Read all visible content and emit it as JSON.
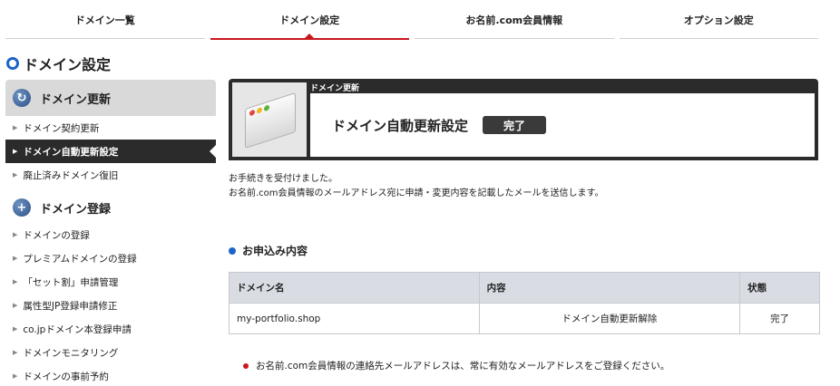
{
  "topnav": {
    "tabs": [
      {
        "label": "ドメイン一覧",
        "active": false
      },
      {
        "label": "ドメイン設定",
        "active": true
      },
      {
        "label": "お名前.com会員情報",
        "active": false
      },
      {
        "label": "オプション設定",
        "active": false
      }
    ]
  },
  "page": {
    "title": "ドメイン設定"
  },
  "sidebar": {
    "group1": {
      "title": "ドメイン更新",
      "icon": "refresh-icon",
      "items": [
        "ドメイン契約更新",
        "ドメイン自動更新設定",
        "廃止済みドメイン復旧"
      ],
      "active_index": 1
    },
    "group2": {
      "title": "ドメイン登録",
      "icon": "plus-circle-icon",
      "items": [
        "ドメインの登録",
        "プレミアムドメインの登録",
        "「セット割」申請管理",
        "属性型JP登録申請修正",
        "co.jpドメイン本登録申請",
        "ドメインモニタリング",
        "ドメインの事前予約"
      ]
    }
  },
  "banner": {
    "small_label": "ドメイン更新",
    "title": "ドメイン自動更新設定",
    "badge": "完了",
    "icon": "browser-window-icon"
  },
  "message": {
    "line1": "お手続きを受付けました。",
    "line2": "お名前.com会員情報のメールアドレス宛に申請・変更内容を記載したメールを送信します。"
  },
  "section": {
    "title": "お申込み内容"
  },
  "table": {
    "headers": [
      "ドメイン名",
      "内容",
      "状態"
    ],
    "rows": [
      [
        "my-portfolio.shop",
        "ドメイン自動更新解除",
        "完了"
      ]
    ]
  },
  "notice": {
    "text": "お名前.com会員情報の連絡先メールアドレスは、常に有効なメールアドレスをご登録ください。"
  },
  "colors": {
    "accent_red": "#c8161d",
    "accent_blue": "#1d64c8",
    "dark": "#2b2b2b"
  }
}
